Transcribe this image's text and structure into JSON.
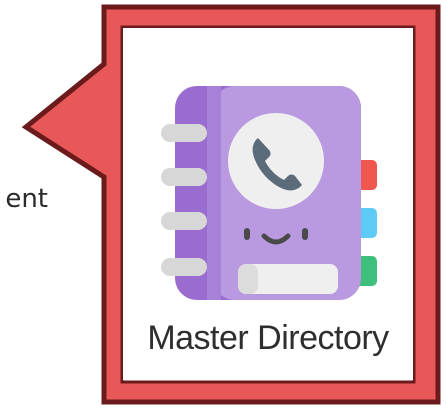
{
  "background_text": {
    "partial_label": "ent"
  },
  "callout": {
    "border_color": "#6b1b1b",
    "fill_color": "#e85858"
  },
  "app": {
    "label": "Master Directory",
    "icon": "address-book-icon"
  }
}
